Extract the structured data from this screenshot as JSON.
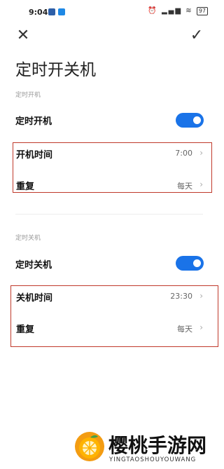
{
  "status_bar": {
    "time": "9:04",
    "icons": [
      "alarm-icon",
      "signal-icon",
      "wifi-icon"
    ],
    "battery": "97"
  },
  "header": {
    "close_icon": "close-icon",
    "confirm_icon": "check-icon",
    "title": "定时开关机"
  },
  "power_on": {
    "section_label": "定时开机",
    "toggle_label": "定时开机",
    "toggle_on": true,
    "time_label": "开机时间",
    "time_value": "7:00",
    "repeat_label": "重复",
    "repeat_value": "每天"
  },
  "power_off": {
    "section_label": "定时关机",
    "toggle_label": "定时关机",
    "toggle_on": true,
    "time_label": "关机时间",
    "time_value": "23:30",
    "repeat_label": "重复",
    "repeat_value": "每天"
  },
  "colors": {
    "toggle_on": "#1a73e8",
    "highlight_box": "#c0392b"
  },
  "watermark": {
    "title": "樱桃手游网",
    "subtitle": "YINGTAOSHOUYOUWANG"
  }
}
